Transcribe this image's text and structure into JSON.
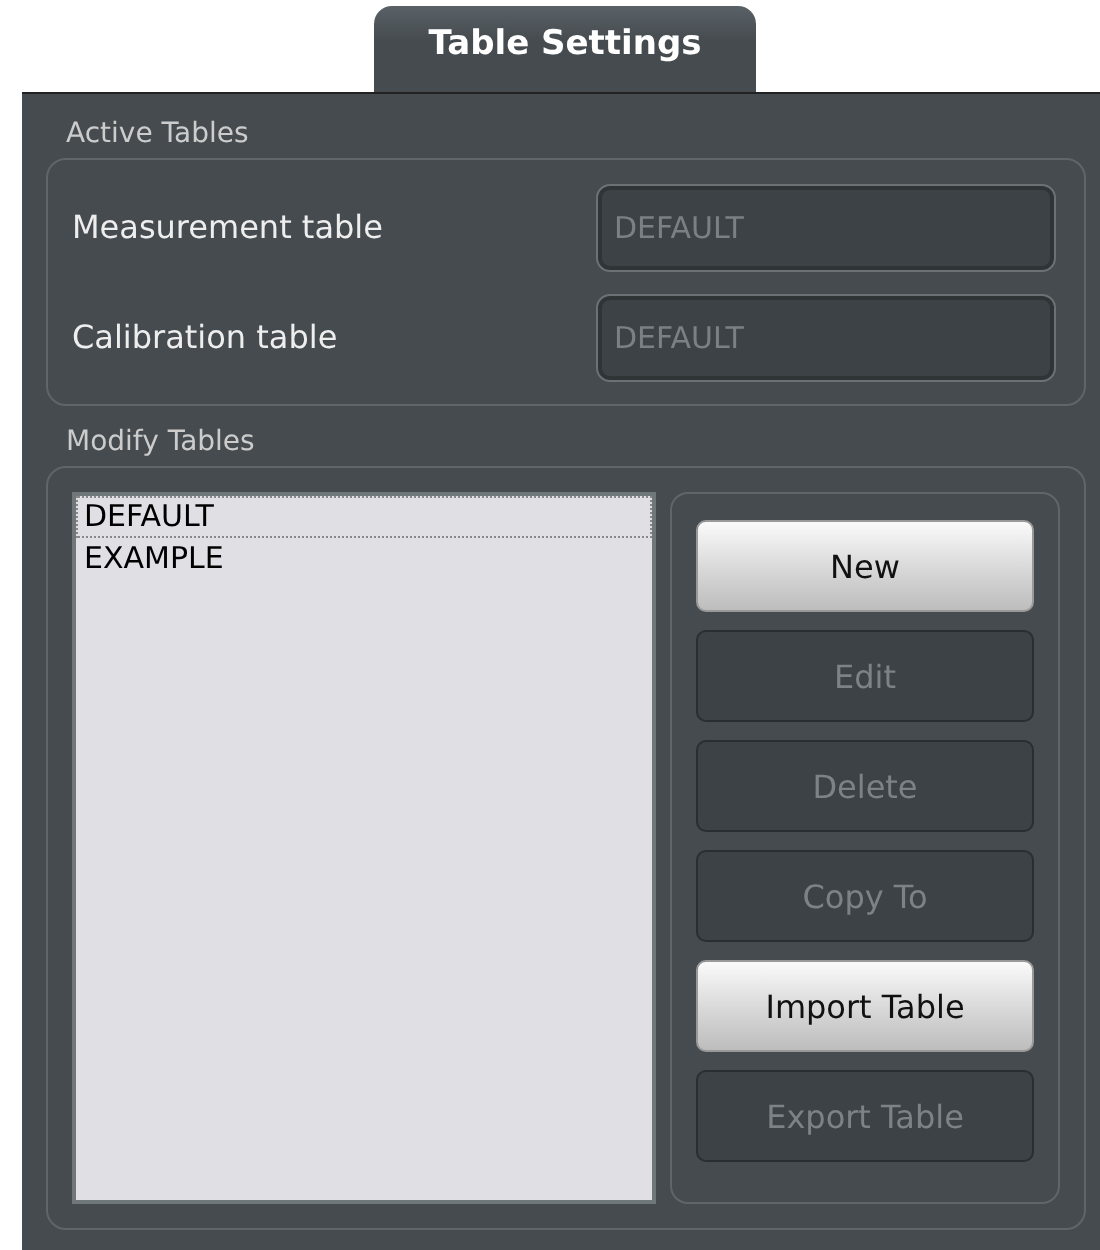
{
  "tab": {
    "label": "Table Settings",
    "selected": true
  },
  "active_tables": {
    "title": "Active Tables",
    "fields": [
      {
        "label": "Measurement table",
        "value": "DEFAULT",
        "disabled": true
      },
      {
        "label": "Calibration table",
        "value": "DEFAULT",
        "disabled": true
      }
    ]
  },
  "modify_tables": {
    "title": "Modify Tables",
    "list": [
      {
        "label": "DEFAULT",
        "selected": true
      },
      {
        "label": "EXAMPLE",
        "selected": false
      }
    ],
    "buttons": [
      {
        "label": "New",
        "disabled": false
      },
      {
        "label": "Edit",
        "disabled": true
      },
      {
        "label": "Delete",
        "disabled": true
      },
      {
        "label": "Copy To",
        "disabled": true
      },
      {
        "label": "Import Table",
        "disabled": false
      },
      {
        "label": "Export Table",
        "disabled": true
      }
    ]
  }
}
